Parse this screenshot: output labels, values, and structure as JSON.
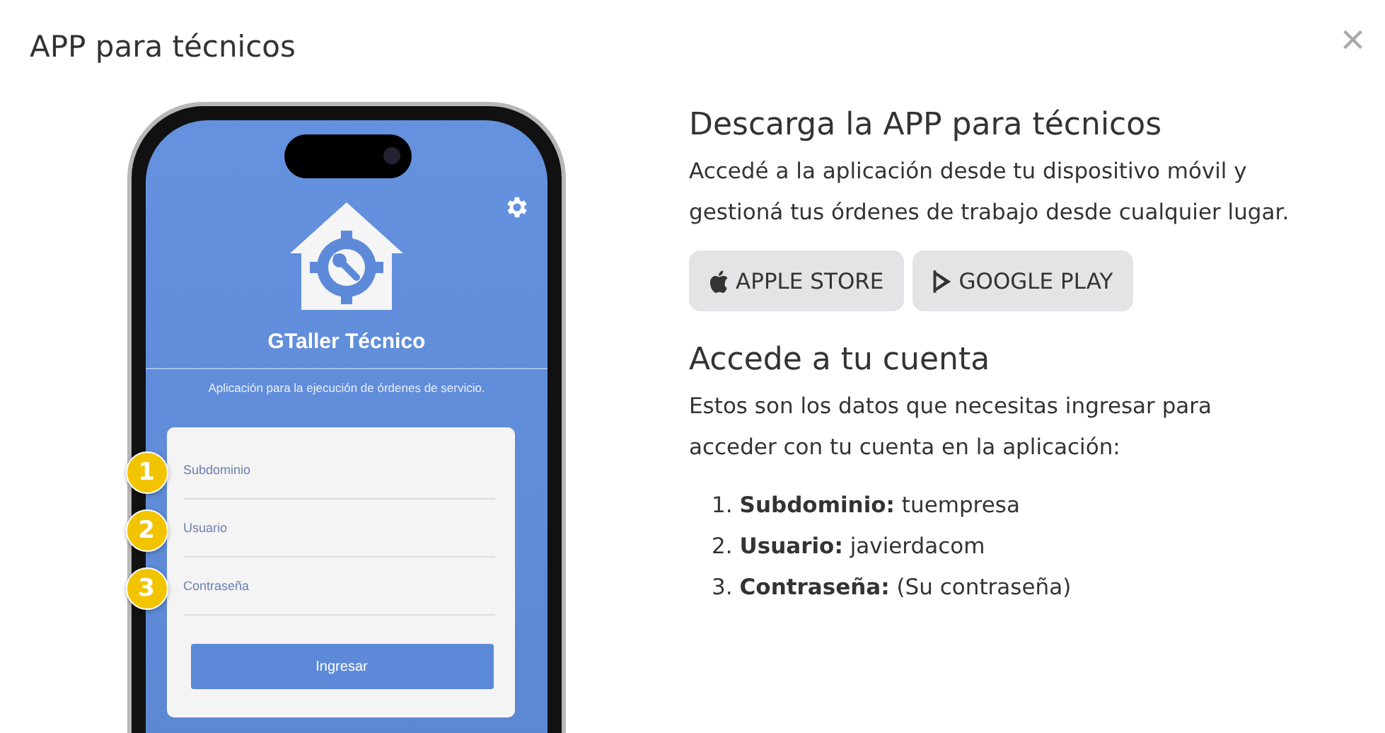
{
  "modal": {
    "title": "APP para técnicos",
    "close": "×"
  },
  "phone": {
    "app_name": "GTaller Técnico",
    "subtitle": "Aplicación para la ejecución de órdenes de servicio.",
    "fields": [
      {
        "badge": "1",
        "placeholder": "Subdominio"
      },
      {
        "badge": "2",
        "placeholder": "Usuario"
      },
      {
        "badge": "3",
        "placeholder": "Contraseña"
      }
    ],
    "button": "Ingresar"
  },
  "download": {
    "heading": "Descarga la APP para técnicos",
    "text": "Accedé a la aplicación desde tu dispositivo móvil y gestioná tus órdenes de trabajo desde cualquier lugar.",
    "stores": [
      {
        "kind": "apple",
        "label": "APPLE STORE"
      },
      {
        "kind": "google",
        "label": "GOOGLE PLAY"
      }
    ]
  },
  "account": {
    "heading": "Accede a tu cuenta",
    "text": "Estos son los datos que necesitas ingresar para acceder con tu cuenta en la aplicación:",
    "items": [
      {
        "number": "1.",
        "text": "**Subdominio:** tuempresa"
      },
      {
        "number": "2.",
        "text": "**Usuario:** javierdacom"
      },
      {
        "number": "3.",
        "text": "**Contraseña:** (Su contraseña)"
      }
    ]
  }
}
